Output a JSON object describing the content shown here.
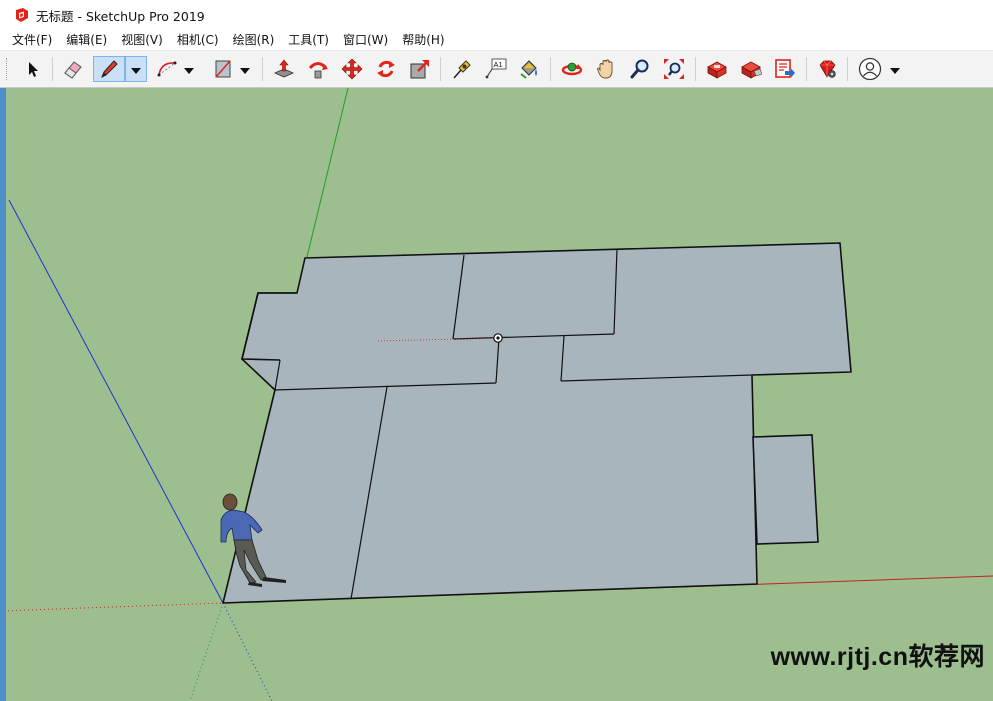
{
  "window": {
    "title": "无标题 - SketchUp Pro 2019",
    "app_icon": "sketchup-logo-icon"
  },
  "menu": {
    "items": [
      {
        "id": "file",
        "label": "文件(F)"
      },
      {
        "id": "edit",
        "label": "编辑(E)"
      },
      {
        "id": "view",
        "label": "视图(V)"
      },
      {
        "id": "camera",
        "label": "相机(C)"
      },
      {
        "id": "draw",
        "label": "绘图(R)"
      },
      {
        "id": "tools",
        "label": "工具(T)"
      },
      {
        "id": "window",
        "label": "窗口(W)"
      },
      {
        "id": "help",
        "label": "帮助(H)"
      }
    ]
  },
  "toolbar": {
    "tools": [
      {
        "id": "select",
        "icon": "select-arrow-icon"
      },
      {
        "id": "eraser",
        "icon": "eraser-icon"
      },
      {
        "id": "line",
        "icon": "pencil-line-icon",
        "active": true
      },
      {
        "id": "arc",
        "icon": "arc-icon"
      },
      {
        "id": "shape",
        "icon": "rectangle-shape-icon"
      },
      {
        "id": "push-pull",
        "icon": "push-pull-icon"
      },
      {
        "id": "follow-me",
        "icon": "follow-me-icon"
      },
      {
        "id": "move",
        "icon": "move-icon"
      },
      {
        "id": "rotate",
        "icon": "rotate-icon"
      },
      {
        "id": "scale",
        "icon": "scale-icon"
      },
      {
        "id": "tape-measure",
        "icon": "tape-measure-icon"
      },
      {
        "id": "text",
        "icon": "text-label-icon",
        "text": "A1"
      },
      {
        "id": "paint-bucket",
        "icon": "paint-bucket-icon"
      },
      {
        "id": "orbit",
        "icon": "orbit-icon"
      },
      {
        "id": "pan",
        "icon": "pan-hand-icon"
      },
      {
        "id": "zoom",
        "icon": "zoom-magnifier-icon"
      },
      {
        "id": "zoom-extents",
        "icon": "zoom-extents-icon"
      },
      {
        "id": "3d-warehouse",
        "icon": "3d-warehouse-icon"
      },
      {
        "id": "extension-warehouse",
        "icon": "extension-warehouse-icon"
      },
      {
        "id": "layout",
        "icon": "send-to-layout-icon"
      },
      {
        "id": "extension-manager",
        "icon": "ruby-extension-icon"
      },
      {
        "id": "account",
        "icon": "user-account-icon"
      }
    ]
  },
  "colors": {
    "ground": "#9dbe8f",
    "face": "#a9b5bd",
    "edge": "#111111",
    "axis_red": "#c0231e",
    "axis_green": "#1fa01f",
    "axis_blue": "#2233cc",
    "tool_active": "#c9e0f7"
  },
  "watermark": {
    "text": "www.rjtj.cn软荐网"
  }
}
